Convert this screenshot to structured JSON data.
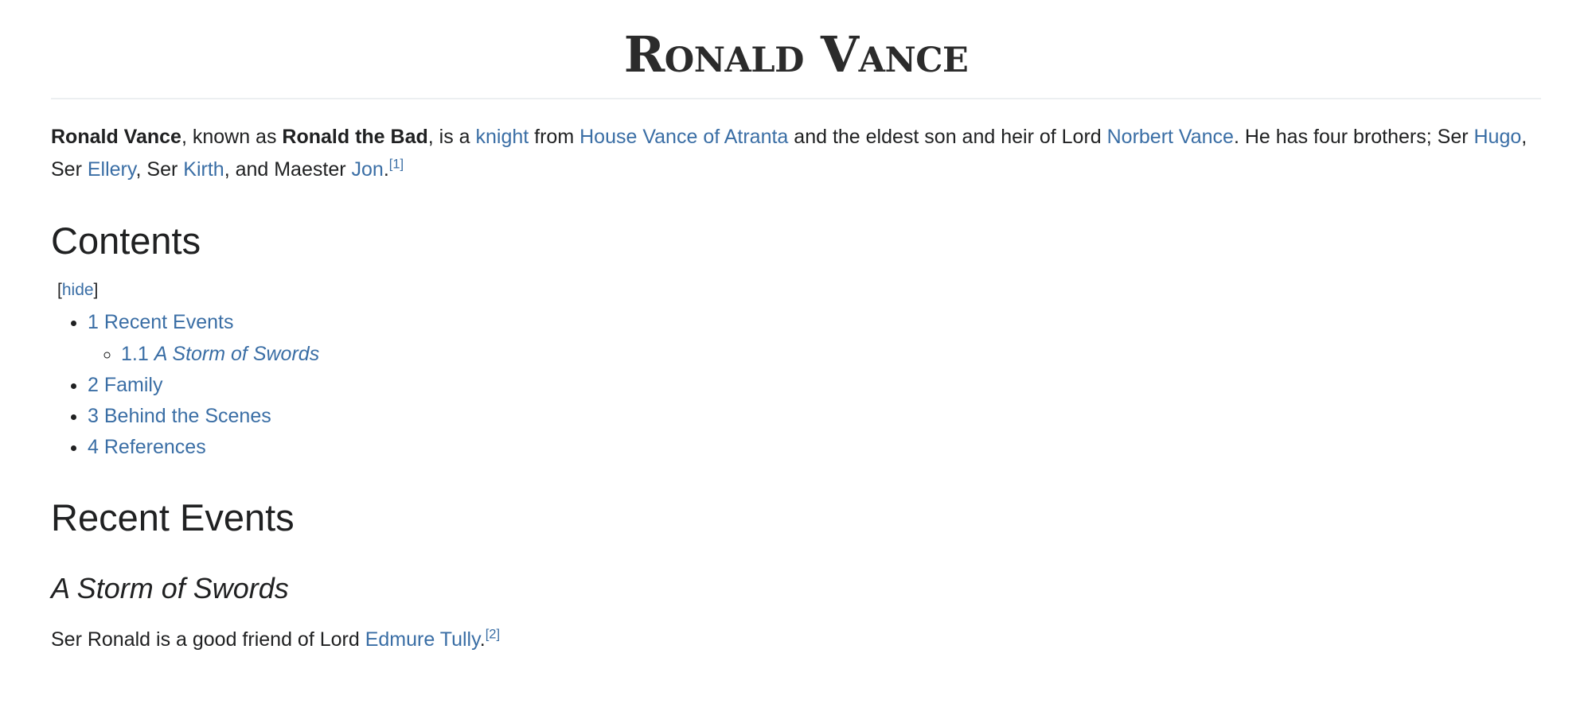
{
  "article": {
    "title": "Ronald Vance",
    "lead": {
      "subject_bold": "Ronald Vance",
      "known_as_text": ", known as ",
      "alias_bold": "Ronald the Bad",
      "after_alias": ", is a ",
      "link_knight": "knight",
      "from_text": " from ",
      "link_house": "House Vance of Atranta",
      "middle_text": " and the eldest son and heir of Lord ",
      "link_father": "Norbert Vance",
      "after_father": ". He has four brothers; Ser ",
      "link_hugo": "Hugo",
      "sep1": ", Ser ",
      "link_ellery": "Ellery",
      "sep2": ", Ser ",
      "link_kirth": "Kirth",
      "sep3": ", and Maester ",
      "link_jon": "Jon",
      "end_punct": ".",
      "ref1": "[1]"
    },
    "contents": {
      "heading": "Contents",
      "toggle_open_bracket": "[",
      "toggle_label": "hide",
      "toggle_close_bracket": "]",
      "items": [
        {
          "number": "1",
          "label": "Recent Events",
          "italic": false,
          "children": [
            {
              "number": "1.1",
              "label": "A Storm of Swords",
              "italic": true
            }
          ]
        },
        {
          "number": "2",
          "label": "Family",
          "italic": false,
          "children": []
        },
        {
          "number": "3",
          "label": "Behind the Scenes",
          "italic": false,
          "children": []
        },
        {
          "number": "4",
          "label": "References",
          "italic": false,
          "children": []
        }
      ]
    },
    "sections": {
      "recent_events_heading": "Recent Events",
      "storm_of_swords_heading": "A Storm of Swords",
      "storm_body": {
        "before_link": "Ser Ronald is a good friend of Lord ",
        "link_edmure": "Edmure Tully",
        "end_punct": ".",
        "ref2": "[2]"
      }
    }
  },
  "colors": {
    "link": "#3a6ea5",
    "text": "#202122",
    "rule": "#eceff1",
    "background": "#ffffff"
  }
}
